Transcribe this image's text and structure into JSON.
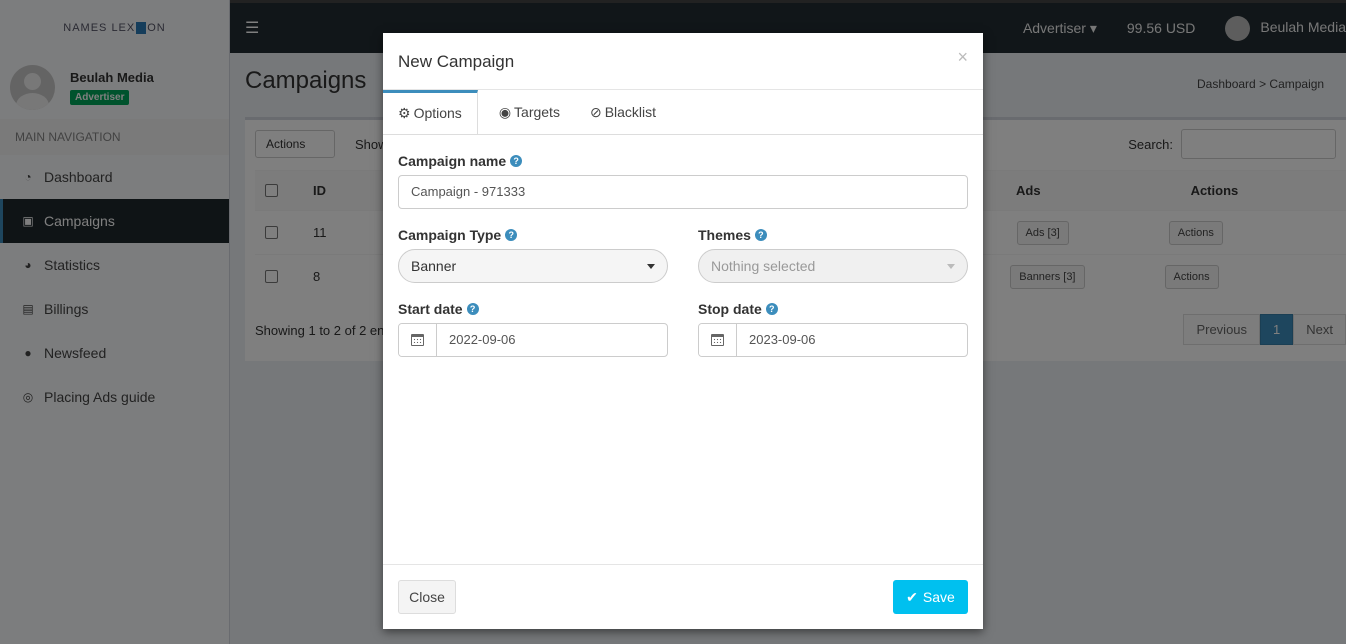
{
  "brand": {
    "logo_text_left": "NAMES LEX",
    "logo_text_right": "ON"
  },
  "user": {
    "name": "Beulah Media",
    "role_badge": "Advertiser"
  },
  "sidebar": {
    "header": "MAIN NAVIGATION",
    "items": [
      {
        "label": "Dashboard",
        "icon": "dashboard-icon"
      },
      {
        "label": "Campaigns",
        "icon": "shopping-basket-icon"
      },
      {
        "label": "Statistics",
        "icon": "pie-chart-icon"
      },
      {
        "label": "Billings",
        "icon": "money-icon"
      },
      {
        "label": "Newsfeed",
        "icon": "comment-icon"
      },
      {
        "label": "Placing Ads guide",
        "icon": "life-ring-icon"
      }
    ]
  },
  "header": {
    "role": "Advertiser",
    "balance": "99.56 USD",
    "user": "Beulah Media"
  },
  "page": {
    "title": "Campaigns",
    "breadcrumb": [
      "Dashboard",
      "Campaign"
    ],
    "actions_select": "Actions",
    "show_label": "Show",
    "search_label": "Search:",
    "columns": {
      "id": "ID",
      "ads": "Ads",
      "actions": "Actions"
    },
    "rows": [
      {
        "id": "11",
        "ads_btn": "Ads [3]",
        "action_btn": "Actions"
      },
      {
        "id": "8",
        "ads_btn": "Banners [3]",
        "action_btn": "Actions"
      }
    ],
    "showing": "Showing 1 to 2 of 2 en",
    "pager": {
      "prev": "Previous",
      "current": "1",
      "next": "Next"
    }
  },
  "modal": {
    "title": "New Campaign",
    "close_symbol": "×",
    "tabs": [
      {
        "label": "Options",
        "icon": "gear-icon"
      },
      {
        "label": "Targets",
        "icon": "bullseye-icon"
      },
      {
        "label": "Blacklist",
        "icon": "ban-icon"
      }
    ],
    "fields": {
      "campaign_name_label": "Campaign name",
      "campaign_name_value": "Campaign - 971333",
      "campaign_type_label": "Campaign Type",
      "campaign_type_value": "Banner",
      "themes_label": "Themes",
      "themes_value": "Nothing selected",
      "start_label": "Start date",
      "start_value": "2022-09-06",
      "stop_label": "Stop date",
      "stop_value": "2023-09-06"
    },
    "footer": {
      "close": "Close",
      "save": "Save"
    }
  }
}
